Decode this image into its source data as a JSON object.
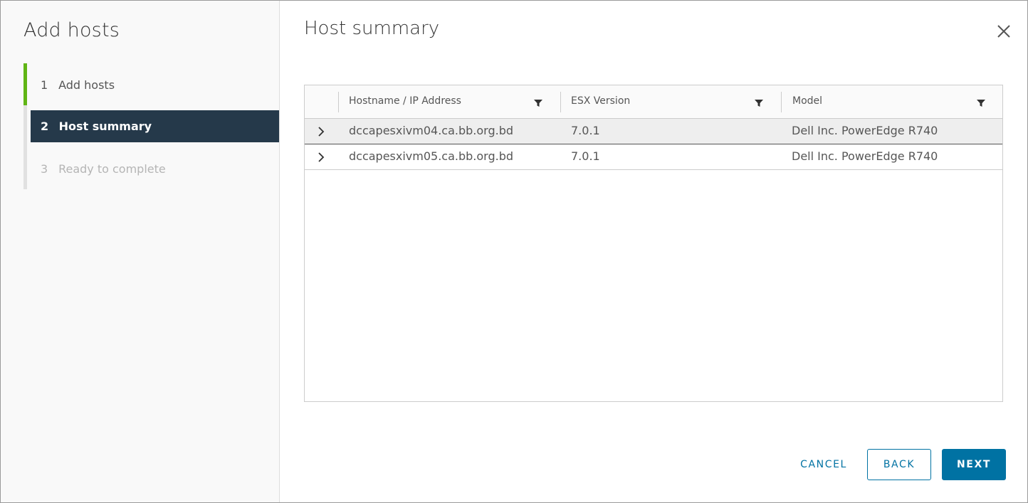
{
  "wizard": {
    "title": "Add hosts",
    "steps": [
      {
        "num": "1",
        "label": "Add hosts"
      },
      {
        "num": "2",
        "label": "Host summary"
      },
      {
        "num": "3",
        "label": "Ready to complete"
      }
    ],
    "active_step": 2
  },
  "page": {
    "title": "Host summary"
  },
  "grid": {
    "columns": [
      "Hostname / IP Address",
      "ESX Version",
      "Model"
    ],
    "rows": [
      {
        "hostname": "dccapesxivm04.ca.bb.org.bd",
        "version": "7.0.1",
        "model": "Dell Inc. PowerEdge R740"
      },
      {
        "hostname": "dccapesxivm05.ca.bb.org.bd",
        "version": "7.0.1",
        "model": "Dell Inc. PowerEdge R740"
      }
    ]
  },
  "footer": {
    "cancel_label": "CANCEL",
    "back_label": "BACK",
    "next_label": "NEXT"
  },
  "colors": {
    "accent": "#0072a3",
    "active_step_bg": "#25394a",
    "done_step": "#60b515"
  },
  "icons": {
    "close": "close-icon",
    "filter": "filter-icon",
    "expand": "chevron-right-icon"
  }
}
